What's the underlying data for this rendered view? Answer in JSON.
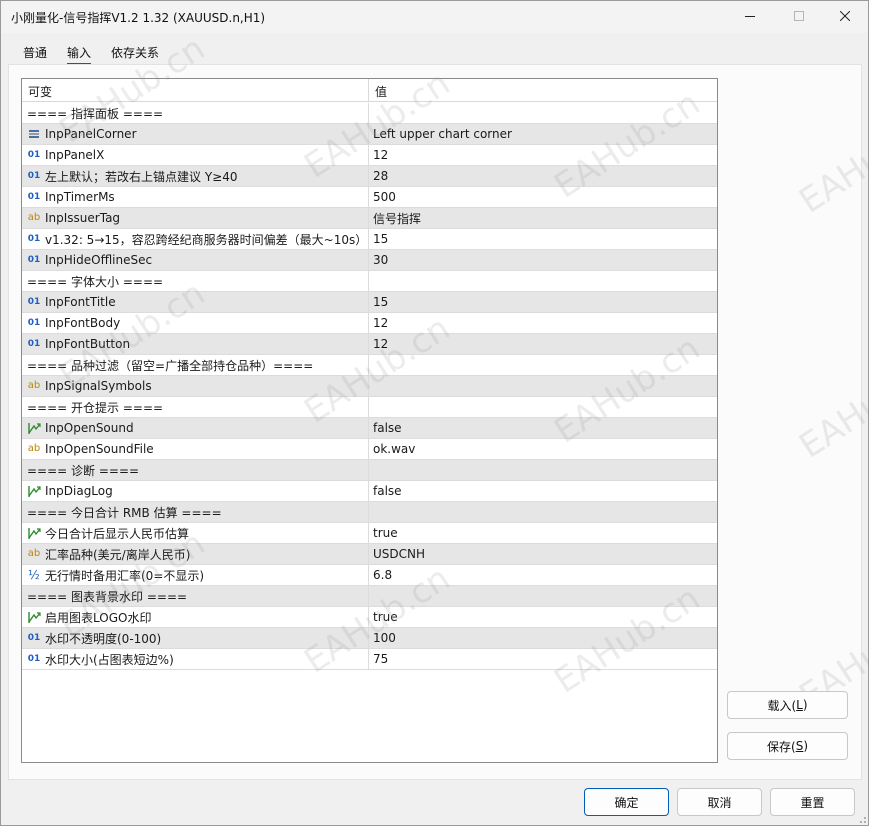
{
  "window": {
    "title": "小刚量化-信号指挥V1.2 1.32 (XAUUSD.n,H1)"
  },
  "tabs": [
    {
      "label": "普通",
      "active": false
    },
    {
      "label": "输入",
      "active": true
    },
    {
      "label": "依存关系",
      "active": false
    }
  ],
  "table": {
    "headers": {
      "variable": "可变",
      "value": "值"
    },
    "rows": [
      {
        "type": "section",
        "name": "==== 指挥面板 ====",
        "value": ""
      },
      {
        "type": "enum",
        "name": "InpPanelCorner",
        "value": "Left upper chart corner"
      },
      {
        "type": "int",
        "name": "InpPanelX",
        "value": "12"
      },
      {
        "type": "int",
        "name": "左上默认；若改右上锚点建议 Y≥40",
        "value": "28"
      },
      {
        "type": "int",
        "name": "InpTimerMs",
        "value": "500"
      },
      {
        "type": "string",
        "name": "InpIssuerTag",
        "value": "信号指挥"
      },
      {
        "type": "int",
        "name": "v1.32: 5→15，容忍跨经纪商服务器时间偏差（最大~10s）",
        "value": "15"
      },
      {
        "type": "int",
        "name": "InpHideOfflineSec",
        "value": "30"
      },
      {
        "type": "section",
        "name": "==== 字体大小 ====",
        "value": ""
      },
      {
        "type": "int",
        "name": "InpFontTitle",
        "value": "15"
      },
      {
        "type": "int",
        "name": "InpFontBody",
        "value": "12"
      },
      {
        "type": "int",
        "name": "InpFontButton",
        "value": "12"
      },
      {
        "type": "section",
        "name": "==== 品种过滤（留空=广播全部持仓品种）====",
        "value": ""
      },
      {
        "type": "string",
        "name": "InpSignalSymbols",
        "value": ""
      },
      {
        "type": "section",
        "name": "==== 开仓提示 ====",
        "value": ""
      },
      {
        "type": "bool",
        "name": "InpOpenSound",
        "value": "false"
      },
      {
        "type": "string",
        "name": "InpOpenSoundFile",
        "value": "ok.wav"
      },
      {
        "type": "section",
        "name": "==== 诊断 ====",
        "value": ""
      },
      {
        "type": "bool",
        "name": "InpDiagLog",
        "value": "false"
      },
      {
        "type": "section",
        "name": "==== 今日合计 RMB 估算 ====",
        "value": ""
      },
      {
        "type": "bool",
        "name": "今日合计后显示人民币估算",
        "value": "true"
      },
      {
        "type": "string",
        "name": "汇率品种(美元/离岸人民币)",
        "value": "USDCNH"
      },
      {
        "type": "double",
        "name": "无行情时备用汇率(0=不显示)",
        "value": "6.8"
      },
      {
        "type": "section",
        "name": "==== 图表背景水印 ====",
        "value": ""
      },
      {
        "type": "bool",
        "name": "启用图表LOGO水印",
        "value": "true"
      },
      {
        "type": "int",
        "name": "水印不透明度(0-100)",
        "value": "100"
      },
      {
        "type": "int",
        "name": "水印大小(占图表短边%)",
        "value": "75"
      }
    ]
  },
  "icons": {
    "int": "01",
    "string": "ab",
    "double": "½"
  },
  "watermark": {
    "text": "EAHub.cn"
  },
  "side_buttons": {
    "load_label": "载入(",
    "load_key": "L",
    "load_close": ")",
    "save_label": "保存(",
    "save_key": "S",
    "save_close": ")"
  },
  "footer": {
    "ok": "确定",
    "cancel": "取消",
    "reset": "重置"
  },
  "colors": {
    "accent": "#005fb8",
    "row_alt": "#e6e6e6"
  }
}
